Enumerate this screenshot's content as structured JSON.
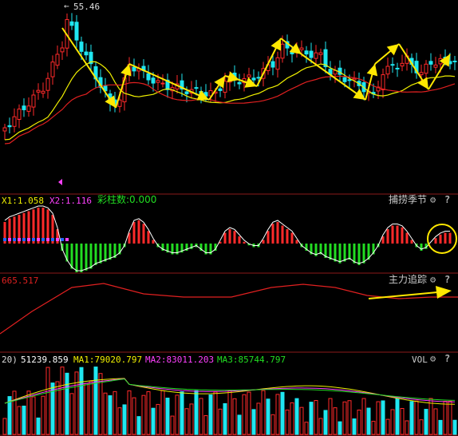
{
  "colors": {
    "up": "#ff2a2a",
    "down": "#1fe6f0",
    "ma_yellow": "#f0f000",
    "ma_red": "#e02020",
    "arrow": "#ffe800",
    "magenta": "#ff40ff",
    "green": "#22dd22",
    "white": "#ffffff",
    "divider": "#8b1a1a"
  },
  "price_panel": {
    "high_label": "55.46",
    "arrow_glyph": "←"
  },
  "indicator1": {
    "x1_label": "X1:1.058",
    "x2_label": "X2:1.116",
    "bars_label": "彩柱数:0.000",
    "name": "捕捞季节"
  },
  "indicator2": {
    "value_label": "665.517",
    "name": "主力追踪"
  },
  "volume_panel": {
    "period_label": "20)",
    "vol_value": "51239.859",
    "ma1_label": "MA1:79020.797",
    "ma2_label": "MA2:83011.203",
    "ma3_label": "MA3:85744.797",
    "name": "VOL"
  },
  "icons": {
    "settings": "gear-icon",
    "help": "question-icon"
  },
  "chart_data": [
    {
      "type": "candlestick",
      "title": "",
      "annotations": [
        "55.46"
      ],
      "max_high": 55.46,
      "trend_arrows": "yellow zigzag arrows following swing highs and lows"
    },
    {
      "type": "bar",
      "name": "捕捞季节",
      "series": [
        {
          "name": "X1",
          "last": 1.058
        },
        {
          "name": "X2",
          "last": 1.116
        }
      ],
      "bars_count": 0.0,
      "histogram": [
        0.6,
        0.7,
        0.75,
        0.8,
        0.85,
        0.9,
        0.95,
        1.0,
        1.0,
        0.95,
        0.8,
        0.4,
        -0.2,
        -0.5,
        -0.7,
        -0.8,
        -0.8,
        -0.75,
        -0.7,
        -0.6,
        -0.55,
        -0.5,
        -0.45,
        -0.4,
        -0.3,
        -0.1,
        0.3,
        0.6,
        0.65,
        0.55,
        0.35,
        0.1,
        -0.1,
        -0.2,
        -0.25,
        -0.3,
        -0.3,
        -0.25,
        -0.2,
        -0.15,
        -0.1,
        -0.2,
        -0.3,
        -0.3,
        -0.2,
        0.05,
        0.3,
        0.4,
        0.35,
        0.2,
        0.05,
        -0.05,
        -0.1,
        -0.1,
        0.1,
        0.35,
        0.55,
        0.6,
        0.5,
        0.4,
        0.3,
        0.1,
        -0.1,
        -0.2,
        -0.3,
        -0.35,
        -0.3,
        -0.4,
        -0.45,
        -0.5,
        -0.55,
        -0.5,
        -0.45,
        -0.55,
        -0.6,
        -0.55,
        -0.45,
        -0.3,
        -0.1,
        0.2,
        0.4,
        0.5,
        0.5,
        0.45,
        0.3,
        0.1,
        -0.1,
        -0.2,
        -0.15,
        0.0,
        0.15,
        0.25,
        0.3,
        0.3
      ]
    },
    {
      "type": "line",
      "name": "主力追踪",
      "series": [
        {
          "name": "主力追踪",
          "last": 665.517
        }
      ]
    },
    {
      "type": "bar",
      "name": "VOL",
      "series": [
        {
          "name": "VOL",
          "last": 51239.859
        },
        {
          "name": "MA1",
          "last": 79020.797
        },
        {
          "name": "MA2",
          "last": 83011.203
        },
        {
          "name": "MA3",
          "last": 85744.797
        }
      ]
    }
  ]
}
